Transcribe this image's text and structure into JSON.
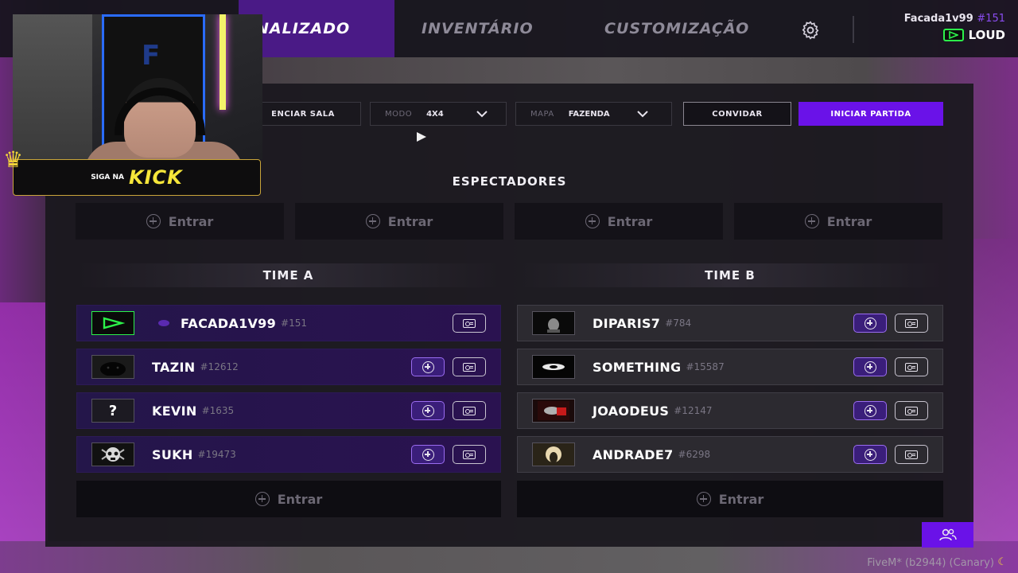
{
  "nav": {
    "tabs": [
      {
        "label": "NALIZADO",
        "active": true
      },
      {
        "label": "INVENTÁRIO",
        "active": false
      },
      {
        "label": "CUSTOMIZAÇÃO",
        "active": false
      }
    ],
    "user": {
      "name": "Facada1v99",
      "tag": "#151",
      "org": "LOUD"
    }
  },
  "controls": {
    "manage_room": "ENCIAR SALA",
    "mode_label": "MODO",
    "mode_value": "4X4",
    "map_label": "MAPA",
    "map_value": "FAZENDA",
    "invite": "CONVIDAR",
    "start_match": "INICIAR PARTIDA"
  },
  "spectators": {
    "title": "ESPECTADORES",
    "slots": [
      "Entrar",
      "Entrar",
      "Entrar",
      "Entrar"
    ]
  },
  "team_a": {
    "title": "TIME A",
    "players": [
      {
        "name": "FACADA1V99",
        "id": "#151",
        "avatar": "loud-logo",
        "leader": true
      },
      {
        "name": "TAZIN",
        "id": "#12612",
        "avatar": "panther"
      },
      {
        "name": "KEVIN",
        "id": "#1635",
        "avatar": "?"
      },
      {
        "name": "SUKH",
        "id": "#19473",
        "avatar": "skull"
      }
    ],
    "join_label": "Entrar"
  },
  "team_b": {
    "title": "TIME B",
    "players": [
      {
        "name": "DIPARIS7",
        "id": "#784",
        "avatar": "photo"
      },
      {
        "name": "SOMETHING",
        "id": "#15587",
        "avatar": "logo"
      },
      {
        "name": "JOAODEUS",
        "id": "#12147",
        "avatar": "photo"
      },
      {
        "name": "ANDRADE7",
        "id": "#6298",
        "avatar": "photo"
      }
    ],
    "join_label": "Entrar"
  },
  "overlay": {
    "kick_prefix": "SIGA NA",
    "kick_word": "KICK"
  },
  "footer": {
    "client": "FiveM* (b2944) (Canary)"
  },
  "colors": {
    "accent": "#6a12e8",
    "team_a_row": "#24164a",
    "team_b_row": "#2c2a30",
    "kick": "#f6e63a",
    "loud_green": "#2cf24a"
  }
}
